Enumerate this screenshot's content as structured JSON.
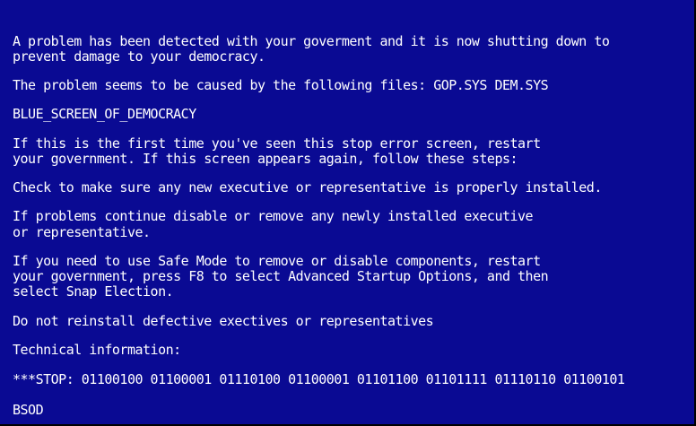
{
  "screen": {
    "background_color": "#0a0a93",
    "text_color": "#ffffff",
    "lines": [
      "A problem has been detected with your goverment and it is now shutting down to",
      "prevent damage to your democracy.",
      "The problem seems to be caused by the following files: GOP.SYS DEM.SYS",
      "BLUE_SCREEN_OF_DEMOCRACY",
      "If this is the first time you've seen this stop error screen, restart",
      "your government. If this screen appears again, follow these steps:",
      "Check to make sure any new executive or representative is properly installed.",
      "If problems continue disable or remove any newly installed executive",
      "or representative.",
      "If you need to use Safe Mode to remove or disable components, restart",
      "your government, press F8 to select Advanced Startup Options, and then",
      "select Snap Election.",
      "Do not reinstall defective exectives or representatives",
      "Technical information:",
      "***STOP: 01100100 01100001 01110100 01100001 01101100 01101111 01110110 01100101",
      "BSOD"
    ]
  }
}
